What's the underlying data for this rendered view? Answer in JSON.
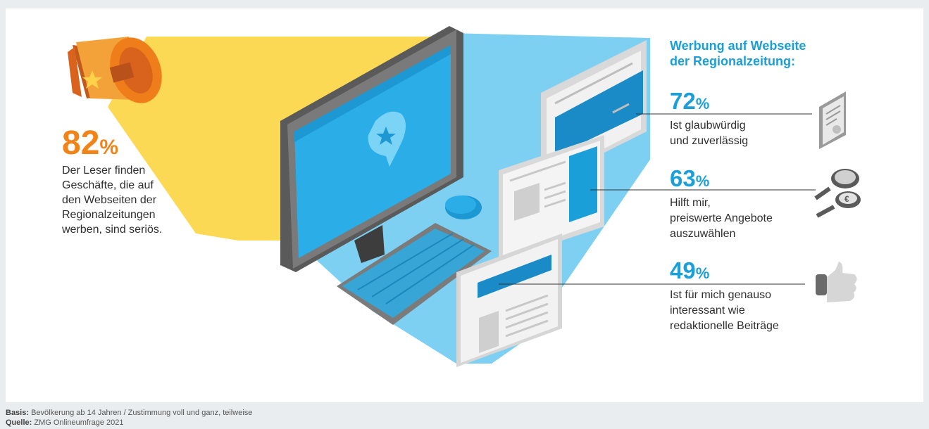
{
  "left_stat": {
    "value": "82",
    "unit": "%",
    "lines": [
      "Der Leser finden",
      "Geschäfte, die auf",
      "den Webseiten der",
      "Regionalzeitungen",
      "werben, sind seriös."
    ]
  },
  "heading": {
    "line1": "Werbung auf Webseite",
    "line2": "der Regionalzeitung:"
  },
  "stats": [
    {
      "value": "72",
      "unit": "%",
      "lines": [
        "Ist glaubwürdig",
        "und zuverlässig"
      ],
      "icon": "certificate-icon"
    },
    {
      "value": "63",
      "unit": "%",
      "lines": [
        "Hilft mir,",
        "preiswerte Angebote",
        "auszuwählen"
      ],
      "icon": "magnifier-euro-icon"
    },
    {
      "value": "49",
      "unit": "%",
      "lines": [
        "Ist für mich genauso",
        "interessant wie",
        "redaktionelle Beiträge"
      ],
      "icon": "thumbs-up-icon"
    }
  ],
  "footer": {
    "basis_label": "Basis:",
    "basis_text": "Bevölkerung ab 14 Jahren / Zustimmung voll und ganz, teilweise",
    "source_label": "Quelle:",
    "source_text": "ZMG Onlineumfrage 2021"
  },
  "colors": {
    "orange": "#f08419",
    "blue": "#1a9fd9",
    "yellow_beam": "#fcd955",
    "light_blue_beam": "#7ed0f3"
  }
}
